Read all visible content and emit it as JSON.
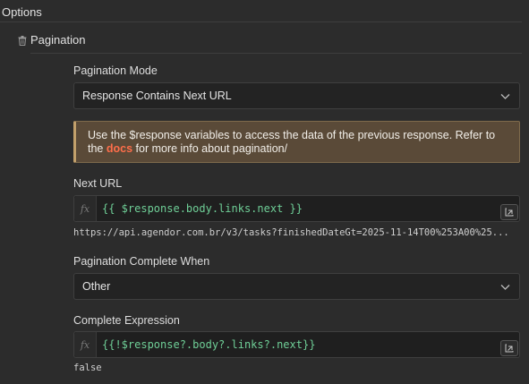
{
  "section": {
    "title": "Options"
  },
  "group": {
    "title": "Pagination",
    "icon": "trash-icon"
  },
  "pagination_mode": {
    "label": "Pagination Mode",
    "value": "Response Contains Next URL"
  },
  "notice": {
    "text_before": "Use the $response variables to access the data of the previous response. Refer to the ",
    "link": "docs",
    "text_after": " for more info about pagination/",
    "link_color": "#ff6e4a"
  },
  "next_url": {
    "label": "Next URL",
    "expression": "{{ $response.body.links.next }}",
    "preview": "https://api.agendor.com.br/v3/tasks?finishedDateGt=2025-11-14T00%253A00%25..."
  },
  "complete_when": {
    "label": "Pagination Complete When",
    "value": "Other"
  },
  "complete_expression": {
    "label": "Complete Expression",
    "expression": "{{!$response?.body?.links?.next}}",
    "preview": "false"
  },
  "colors": {
    "background": "#2c2c2c",
    "expression_text": "#6fcf97",
    "notice_background": "#5a4a38",
    "notice_border": "#c2a06b"
  }
}
